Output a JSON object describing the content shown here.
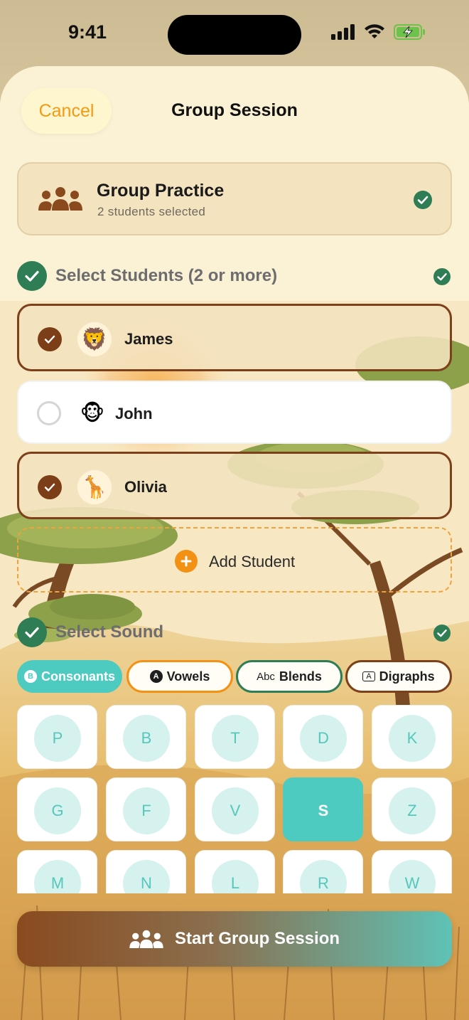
{
  "status_bar": {
    "time": "9:41"
  },
  "header": {
    "cancel_label": "Cancel",
    "title": "Group Session"
  },
  "group_card": {
    "title": "Group Practice",
    "subtitle": "2 students selected",
    "icon": "group-icon"
  },
  "students_section": {
    "label": "Select Students (2 or more)",
    "students": [
      {
        "name": "James",
        "selected": true,
        "avatar": "🦁"
      },
      {
        "name": "John",
        "selected": false,
        "avatar": "🐵"
      },
      {
        "name": "Olivia",
        "selected": true,
        "avatar": "🦒"
      }
    ],
    "add_label": "Add Student"
  },
  "sound_section": {
    "label": "Select Sound",
    "tabs": [
      {
        "label": "Consonants",
        "badge": "B",
        "active": true
      },
      {
        "label": "Vowels",
        "badge": "A",
        "active": false
      },
      {
        "label": "Blends",
        "badge": "Abc",
        "active": false
      },
      {
        "label": "Digraphs",
        "badge": "A",
        "active": false
      }
    ],
    "sounds": [
      "P",
      "B",
      "T",
      "D",
      "K",
      "G",
      "F",
      "V",
      "S",
      "Z",
      "M",
      "N",
      "L",
      "R",
      "W"
    ],
    "selected_sound": "S"
  },
  "start_button": {
    "label": "Start Group Session"
  },
  "colors": {
    "accent_orange": "#f29a14",
    "accent_teal": "#4ecbc0",
    "check_green": "#2e7d55",
    "selected_brown": "#7c401a"
  }
}
